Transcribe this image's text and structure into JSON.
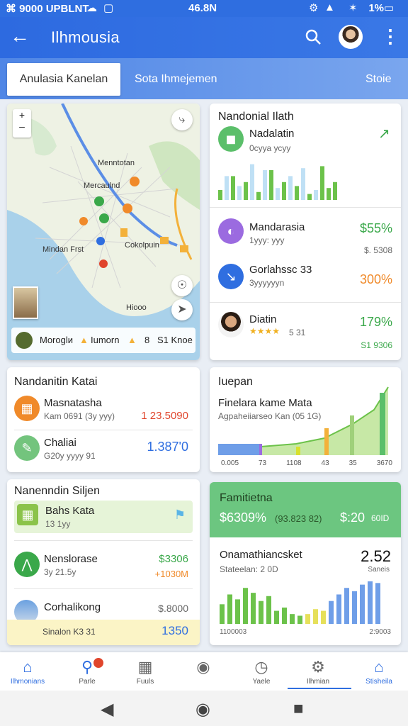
{
  "status": {
    "left": "⌘ 9000 UPBLNT",
    "time": "46.8N",
    "battery": "1%"
  },
  "appbar": {
    "title": "Ilhmousia"
  },
  "tabs": [
    "Anulasia Kanelan",
    "Sota Ihmejemen",
    "Stoie"
  ],
  "map": {
    "labels": [
      "Menntotan",
      "Mercaulnd",
      "Cokolpuin",
      "Mindan Frst",
      "Hiooo"
    ],
    "bar_text_1": "Moroglи",
    "bar_text_2": "Iumorn",
    "bar_text_3": "8",
    "bar_text_4": "S1 Knoe",
    "zoom_in": "+",
    "zoom_out": "–"
  },
  "colors": {
    "primary": "#2f6ee0",
    "green": "#3aa84a",
    "orange": "#f08a2a",
    "red": "#e0452c"
  },
  "card_right1": {
    "title": "Nandonial Ilath",
    "item_title": "Nadalatin",
    "item_sub": "0сууа усуу",
    "bars_green": [
      5,
      12,
      9,
      4,
      15,
      9,
      7,
      3,
      17,
      6,
      9
    ],
    "bars_light": [
      12,
      7,
      18,
      15,
      6,
      12,
      16,
      5
    ],
    "rows": [
      {
        "name": "Mandarasia",
        "sub": "1ууу: ууу",
        "val": "$55%",
        "val2": ""
      },
      {
        "name": "Gorlahssc 33",
        "sub": "3ууууууn",
        "val": "300%",
        "val2": "$. 5308"
      },
      {
        "name": "Diatin",
        "sub": "5 31",
        "val": "179%",
        "val2": "S1 9306"
      }
    ]
  },
  "card_left2": {
    "title": "Nandanitin Katai",
    "rows": [
      {
        "name": "Masnatasha",
        "sub": "Kam 0691 (3у ууу)",
        "val": "1 23.5090"
      },
      {
        "name": "Chaliai",
        "sub": "G20у уууу 91",
        "val": "1.387'0"
      }
    ]
  },
  "card_right2": {
    "title": "Iuepan",
    "subtitle": "Finelara kame Mata",
    "sub2": "Agpaheiiarseo Kan (05 1G)",
    "x_labels": [
      "0.005",
      "73",
      "1108",
      "43",
      "35",
      "3670"
    ]
  },
  "card_left3": {
    "title": "Nanenndin Siljen",
    "highlight": {
      "name": "Bahs Kata",
      "sub": "13 1уу"
    },
    "rows": [
      {
        "name": "Nenslorase",
        "sub": "3у 21.5у",
        "val": "$3306",
        "val2": "+1030M"
      },
      {
        "name": "Corhalikong",
        "sub": "",
        "val": "$.8000",
        "val2": ""
      }
    ],
    "footer_left": "Sinalon K3 31",
    "footer_right": "1350"
  },
  "card_right3": {
    "header_title": "Famitietna",
    "header_val1": "$6309%",
    "header_val2": "(93.823 82)",
    "header_val3": "$:20",
    "header_val4": "60ID",
    "body_title": "Onamathiancsket",
    "body_sub": "Stateelan: 2 0D",
    "body_val": "2.52",
    "body_val_sub": "Saneis",
    "x_left": "1100003",
    "x_right": "2:9003",
    "bars_green": [
      12,
      18,
      15,
      22,
      19,
      14,
      17,
      8,
      10,
      6,
      5
    ],
    "bars_yellow": [
      6,
      9,
      8
    ],
    "bars_blue": [
      14,
      18,
      22,
      20,
      24,
      26,
      25
    ]
  },
  "navbar": [
    "Ilhmonians",
    "Parle",
    "Fuuls",
    "",
    "Yaele",
    "Ilhmian",
    "Stisheila"
  ],
  "stars": "★★★★"
}
